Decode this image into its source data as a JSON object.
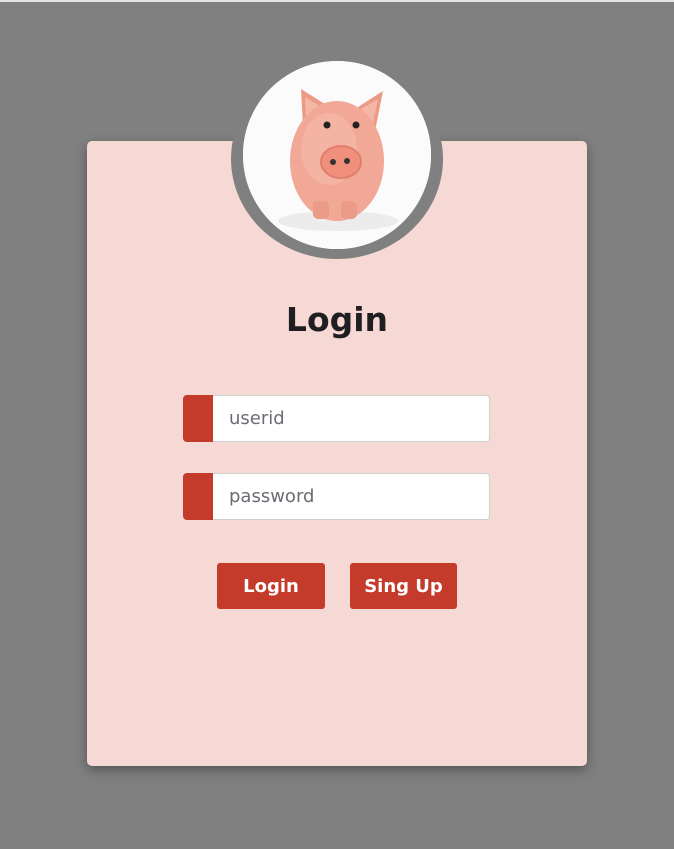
{
  "login_card": {
    "title": "Login",
    "userid_field": {
      "placeholder": "userid"
    },
    "password_field": {
      "placeholder": "password"
    },
    "login_button": "Login",
    "signup_button": "Sing Up"
  },
  "colors": {
    "background": "#808080",
    "card": "#f6d8d5",
    "accent": "#c43a2b",
    "title_text": "#1f1f22"
  },
  "icons": {
    "avatar": "piggy-bank-image"
  }
}
